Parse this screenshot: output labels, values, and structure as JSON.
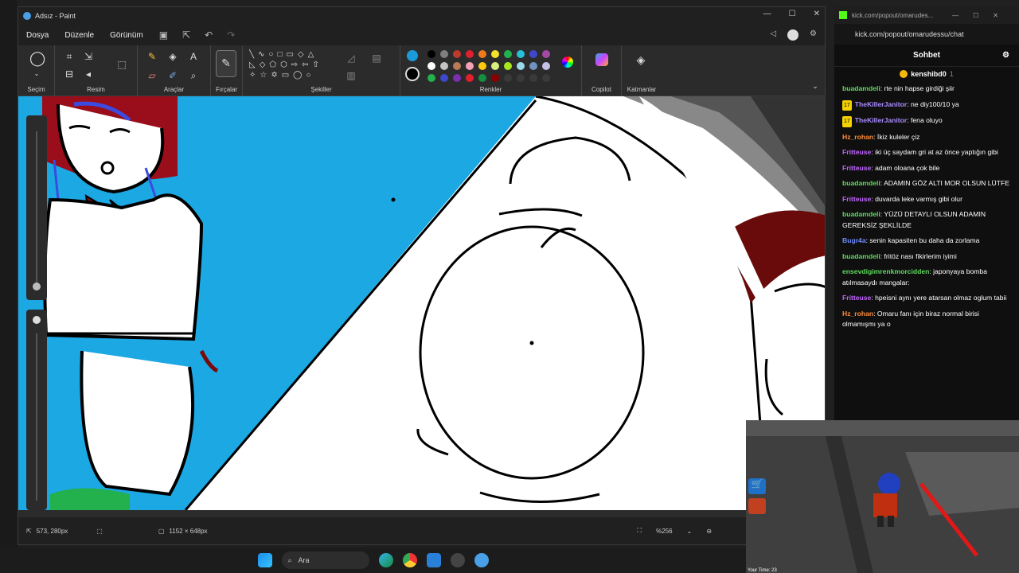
{
  "window": {
    "title": "Adsız - Paint"
  },
  "menu": {
    "file": "Dosya",
    "edit": "Düzenle",
    "view": "Görünüm"
  },
  "ribbon": {
    "groups": {
      "selection": "Seçim",
      "image": "Resim",
      "tools": "Araçlar",
      "brushes": "Fırçalar",
      "shapes": "Şekiller",
      "colors": "Renkler",
      "copilot": "Copilot",
      "layers": "Katmanlar"
    },
    "primary_color": "#1a9ad8",
    "secondary_color": "#000000",
    "palette": [
      "#000000",
      "#7f7f7f",
      "#c0392b",
      "#e0202d",
      "#f07a1c",
      "#f5e12b",
      "#22b14c",
      "#26c0d8",
      "#3f48cc",
      "#a349a4",
      "#ffffff",
      "#c3c3c3",
      "#b97a57",
      "#f5a0b8",
      "#ffc90e",
      "#d8ef80",
      "#a8e61d",
      "#99d9ea",
      "#7092be",
      "#c8bfe7",
      "#22b14c",
      "#3f48cc",
      "#7a2fb0",
      "#e0202d",
      "#158f3f",
      "#8a0000",
      "#3a3a3a",
      "#3a3a3a",
      "#3a3a3a",
      "#3a3a3a"
    ]
  },
  "status": {
    "cursor_pos": "573, 280px",
    "canvas_size": "1152 × 648px",
    "zoom": "%256"
  },
  "taskbar": {
    "search_placeholder": "Ara"
  },
  "chat": {
    "tab_url": "kick.com/popout/omarudes...",
    "url": "kick.com/popout/omarudessu/chat",
    "header": "Sohbet",
    "pinned_user": "kenshibd0",
    "pinned_count": "1",
    "messages": [
      {
        "user": "buadamdeli",
        "color": "#5fdc5f",
        "badge": "",
        "text": "rte nin hapse girdiği şiir"
      },
      {
        "user": "TheKillerJanitor",
        "color": "#a98bff",
        "badge": "17",
        "text": "ne diy100/10 ya"
      },
      {
        "user": "TheKillerJanitor",
        "color": "#a98bff",
        "badge": "17",
        "text": "fena oluyo"
      },
      {
        "user": "Hz_rohan",
        "color": "#ff8c3a",
        "badge": "",
        "text": "İkiz kuleler çiz"
      },
      {
        "user": "Fritteuse",
        "color": "#c066ff",
        "badge": "",
        "text": "iki üç saydam gri at az önce yaptığın gibi"
      },
      {
        "user": "Fritteuse",
        "color": "#c066ff",
        "badge": "",
        "text": "adam oloana çok bile"
      },
      {
        "user": "buadamdeli",
        "color": "#5fdc5f",
        "badge": "",
        "text": "ADAMIN GÖZ ALTI MOR OLSUN LÜTFE"
      },
      {
        "user": "Fritteuse",
        "color": "#c066ff",
        "badge": "",
        "text": "duvarda leke varmış gibi olur"
      },
      {
        "user": "buadamdeli",
        "color": "#5fdc5f",
        "badge": "",
        "text": "YÜZÜ DETAYLI OLSUN ADAMIN GEREKSİZ ŞEKLİLDE"
      },
      {
        "user": "Bugr4a",
        "color": "#6f8cff",
        "badge": "",
        "text": "senin kapasiten bu daha da zorlama"
      },
      {
        "user": "buadamdeli",
        "color": "#5fdc5f",
        "badge": "",
        "text": "fritöz nası fikirlerim iyimi"
      },
      {
        "user": "ensevdigimrenkmorcidden",
        "color": "#5fdc5f",
        "badge": "",
        "text": "japonyaya bomba atılmasaydı mangalar:"
      },
      {
        "user": "Fritteuse",
        "color": "#c066ff",
        "badge": "",
        "text": "hpeisni aynı yere atarsan olmaz oglum tabii"
      },
      {
        "user": "Hz_rohan",
        "color": "#ff8c3a",
        "badge": "",
        "text": "Omaru fanı için biraz normal birisi olmamışmı ya o"
      }
    ]
  },
  "game": {
    "timer_label": "Your Time: 23"
  }
}
